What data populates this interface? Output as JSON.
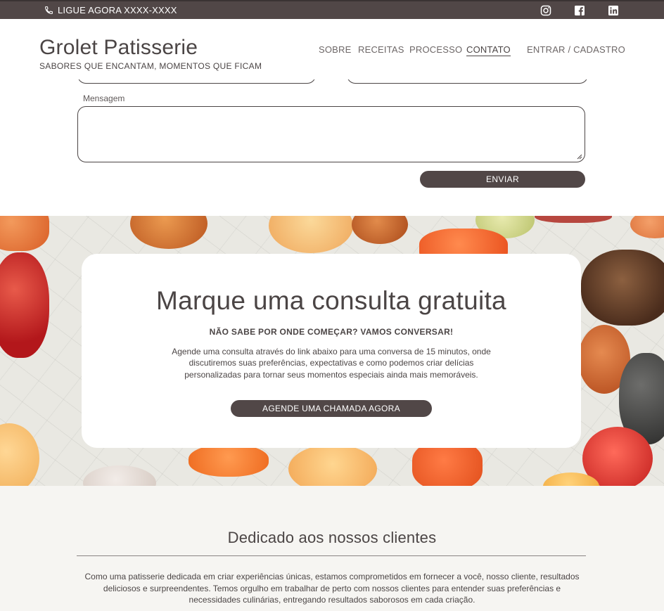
{
  "topbar": {
    "phone_label": "LIGUE AGORA XXXX-XXXX",
    "icons": [
      "phone-icon",
      "instagram-icon",
      "facebook-icon",
      "linkedin-icon"
    ]
  },
  "header": {
    "brand": "Grolet Patisserie",
    "tagline": "SABORES QUE ENCANTAM, MOMENTOS QUE FICAM",
    "nav": [
      {
        "label": "SOBRE"
      },
      {
        "label": "RECEITAS"
      },
      {
        "label": "PROCESSO"
      },
      {
        "label": "CONTATO",
        "active": true
      },
      {
        "label": "ENTRAR / CADASTRO"
      }
    ]
  },
  "form": {
    "message_label": "Mensagem",
    "message_value": "",
    "submit_label": "ENVIAR"
  },
  "consult": {
    "title": "Marque uma consulta gratuita",
    "subtitle": "NÃO SABE POR ONDE COMEÇAR? VAMOS CONVERSAR!",
    "body": "Agende uma consulta através do link abaixo para uma conversa de 15 minutos, onde discutiremos suas preferências, expectativas e como podemos criar delícias personalizadas para tornar seus momentos especiais ainda mais memoráveis.",
    "button_label": "AGENDE UMA CHAMADA AGORA"
  },
  "clients": {
    "title": "Dedicado aos nossos clientes",
    "body": "Como uma patisserie dedicada em criar experiências únicas, estamos comprometidos em fornecer a você, nosso cliente, resultados deliciosos e surpreendentes. Temos orgulho em trabalhar de perto com nossos clientes para entender suas preferências e necessidades culinárias, entregando resultados saborosos em cada criação."
  },
  "colors": {
    "brand_dark": "#514747",
    "text": "#4b4545",
    "section_bg": "#f6f5f2"
  }
}
